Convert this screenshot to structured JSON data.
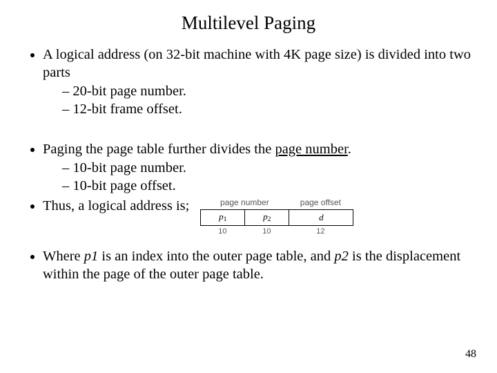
{
  "title": "Multilevel Paging",
  "b1": {
    "intro": "A logical address (on 32-bit machine with 4K page size) is divided into two parts",
    "sub1": "20-bit page number.",
    "sub2": "12-bit frame offset."
  },
  "b2": {
    "intro_a": "Paging the page table further divides the ",
    "intro_underlined": "page number",
    "intro_b": ".",
    "sub1": "10-bit page number.",
    "sub2": "10-bit page offset."
  },
  "b3": "Thus, a logical address is;",
  "fig": {
    "head_left": "page number",
    "head_right": "page offset",
    "c1": "p",
    "c1_sub": "1",
    "c2": "p",
    "c2_sub": "2",
    "c3": "d",
    "w1": "10",
    "w2": "10",
    "w3": "12"
  },
  "b4": {
    "a": "Where ",
    "p1": "p1",
    "b": " is an index into the outer page table, and ",
    "p2": "p2",
    "c": " is the displacement within the page of the outer page table."
  },
  "pagenum": "48"
}
